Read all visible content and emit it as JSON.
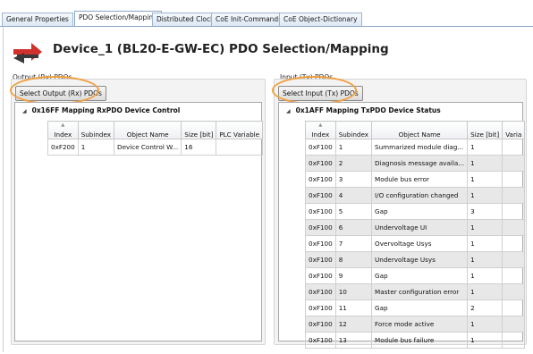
{
  "tabs": [
    {
      "label": "General Properties"
    },
    {
      "label": "PDO Selection/Mapping"
    },
    {
      "label": "Distributed Clock"
    },
    {
      "label": "CoE Init-Commands"
    },
    {
      "label": "CoE Object-Dictionary"
    }
  ],
  "active_tab": "PDO Selection/Mapping",
  "page": {
    "title": "Device_1 (BL20-E-GW-EC) PDO Selection/Mapping",
    "icon": "pdo-mapping-arrows-icon"
  },
  "output": {
    "group_label": "Output (Rx) PDOs",
    "select_button": "Select Output (Rx) PDOs",
    "tree_node": "0x16FF Mapping RxPDO Device Control",
    "columns": [
      "Index",
      "Subindex",
      "Object Name",
      "Size [bit]",
      "PLC Variable"
    ],
    "rows": [
      [
        "0xF200",
        "1",
        "Device Control W...",
        "16",
        ""
      ]
    ]
  },
  "input": {
    "group_label": "Input (Tx) PDOs",
    "select_button": "Select Input (Tx) PDOs",
    "tree_node": "0x1AFF Mapping TxPDO Device Status",
    "columns": [
      "Index",
      "Subindex",
      "Object Name",
      "Size [bit]",
      "Varia"
    ],
    "rows": [
      [
        "0xF100",
        "1",
        "Summarized module diag...",
        "1",
        ""
      ],
      [
        "0xF100",
        "2",
        "Diagnosis message availa...",
        "1",
        ""
      ],
      [
        "0xF100",
        "3",
        "Module bus error",
        "1",
        ""
      ],
      [
        "0xF100",
        "4",
        "I/O configuration changed",
        "1",
        ""
      ],
      [
        "0xF100",
        "5",
        "Gap",
        "3",
        ""
      ],
      [
        "0xF100",
        "6",
        "Undervoltage UI",
        "1",
        ""
      ],
      [
        "0xF100",
        "7",
        "Overvoltage Usys",
        "1",
        ""
      ],
      [
        "0xF100",
        "8",
        "Undervoltage Usys",
        "1",
        ""
      ],
      [
        "0xF100",
        "9",
        "Gap",
        "1",
        ""
      ],
      [
        "0xF100",
        "10",
        "Master configuration error",
        "1",
        ""
      ],
      [
        "0xF100",
        "11",
        "Gap",
        "2",
        ""
      ],
      [
        "0xF100",
        "12",
        "Force mode active",
        "1",
        ""
      ],
      [
        "0xF100",
        "13",
        "Module bus failure",
        "1",
        ""
      ]
    ]
  },
  "colors": {
    "highlight": "#f0a040",
    "icon_red": "#d0312d",
    "alt_row": "#e8e8e8"
  }
}
